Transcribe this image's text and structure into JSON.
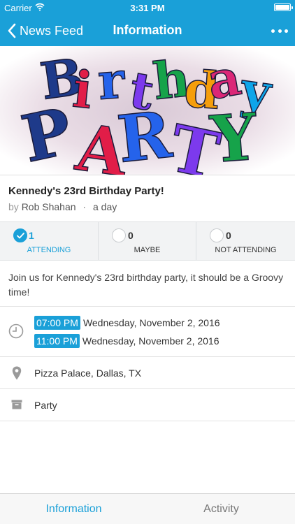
{
  "status_bar": {
    "carrier": "Carrier",
    "time": "3:31 PM"
  },
  "nav": {
    "back_label": "News Feed",
    "title": "Information"
  },
  "banner": {
    "line1": [
      "B",
      "i",
      "r",
      "t",
      "h",
      "d",
      "a",
      "y"
    ],
    "line2": [
      "P",
      "A",
      "R",
      "T",
      "Y"
    ],
    "colors": [
      "#1e3a8a",
      "#e11d48",
      "#2563eb",
      "#7c3aed",
      "#16a34a",
      "#f59e0b",
      "#db2777",
      "#0ea5e9"
    ]
  },
  "event": {
    "title": "Kennedy's 23rd Birthday Party!",
    "by": "by",
    "author": "Rob Shahan",
    "separator": "·",
    "posted": "a day"
  },
  "rsvp": {
    "attending": {
      "count": "1",
      "label": "ATTENDING",
      "checked": true
    },
    "maybe": {
      "count": "0",
      "label": "MAYBE",
      "checked": false
    },
    "not_attending": {
      "count": "0",
      "label": "NOT ATTENDING",
      "checked": false
    }
  },
  "description": "Join us for Kennedy's 23rd birthday party, it should be a Groovy time!",
  "times": [
    {
      "time": "07:00 PM",
      "date": "Wednesday, November 2, 2016"
    },
    {
      "time": "11:00 PM",
      "date": "Wednesday, November 2, 2016"
    }
  ],
  "location": "Pizza Palace, Dallas, TX",
  "category": "Party",
  "tabs": [
    {
      "label": "Information",
      "active": true
    },
    {
      "label": "Activity",
      "active": false
    }
  ],
  "colors": {
    "accent": "#1aa0d8",
    "icon_gray": "#9a9a9a"
  }
}
